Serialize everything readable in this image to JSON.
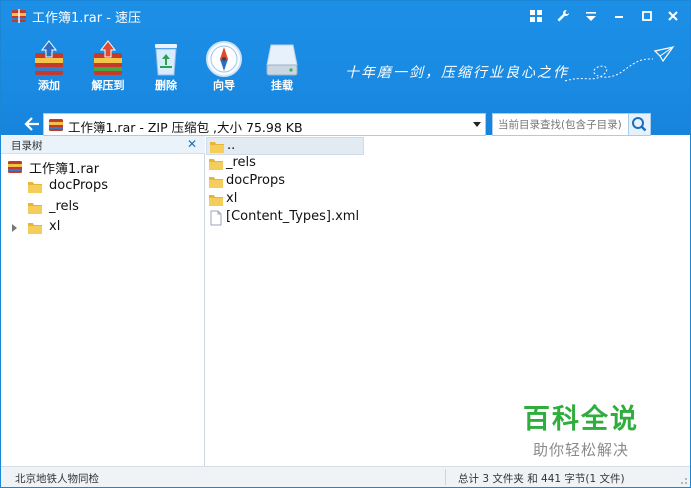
{
  "window": {
    "title": "工作簿1.rar - 速压"
  },
  "toolbar": {
    "items": [
      {
        "label": "添加",
        "icon": "add-archive-icon"
      },
      {
        "label": "解压到",
        "icon": "extract-icon"
      },
      {
        "label": "删除",
        "icon": "recycle-bin-icon"
      },
      {
        "label": "向导",
        "icon": "compass-icon"
      },
      {
        "label": "挂载",
        "icon": "drive-icon"
      }
    ],
    "slogan": "十年磨一剑，压缩行业良心之作"
  },
  "address": {
    "path_text": "工作簿1.rar - ZIP 压缩包 ,大小 75.98 KB"
  },
  "search": {
    "placeholder": "当前目录查找(包含子目录)"
  },
  "tree": {
    "header": "目录树",
    "root": "工作簿1.rar",
    "items": [
      {
        "label": "docProps"
      },
      {
        "label": "_rels"
      },
      {
        "label": "xl"
      }
    ]
  },
  "files": {
    "items": [
      {
        "label": "..",
        "type": "folder"
      },
      {
        "label": "_rels",
        "type": "folder"
      },
      {
        "label": "docProps",
        "type": "folder"
      },
      {
        "label": "xl",
        "type": "folder"
      },
      {
        "label": "[Content_Types].xml",
        "type": "file"
      }
    ]
  },
  "watermark": {
    "brand": "百科全说",
    "tagline": "助你轻松解决"
  },
  "status": {
    "left": "北京地铁人物同检",
    "right": "总计 3 文件夹 和 441 字节(1 文件)"
  },
  "colors": {
    "header_blue": "#1a8ae2",
    "folder_yellow": "#f0c040",
    "watermark_green": "#2fad3d"
  }
}
